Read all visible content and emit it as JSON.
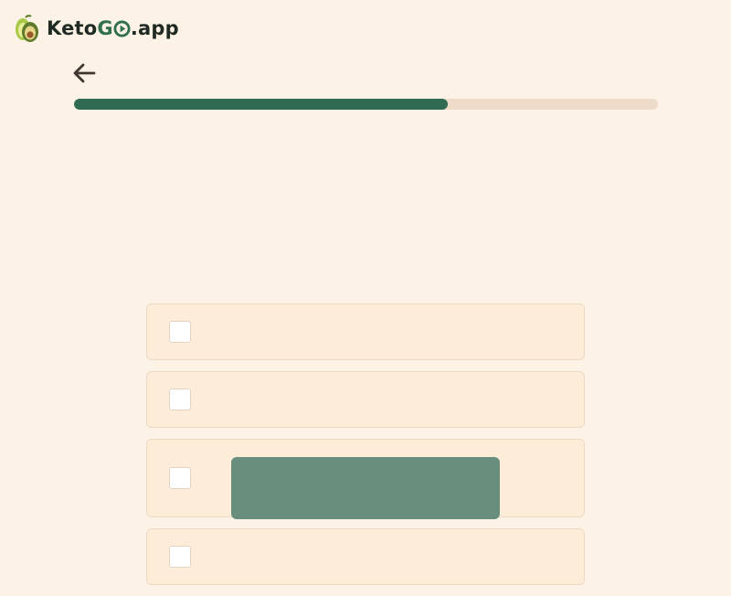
{
  "header": {
    "brand_prefix": "Keto",
    "brand_go_letter": "G",
    "brand_suffix": ".app",
    "logo_icon": "avocado-icon",
    "back_icon": "arrow-left-icon"
  },
  "progress": {
    "value_percent": 64
  },
  "options": [
    {
      "label": "",
      "checked": false
    },
    {
      "label": "",
      "checked": false
    },
    {
      "label": "",
      "checked": false
    },
    {
      "label": "",
      "checked": false
    }
  ],
  "colors": {
    "background": "#fdf2e6",
    "accent_green": "#2f6b52",
    "progress_track": "#efdcc8",
    "option_bg": "#fdecd8",
    "overlay_block": "#688e7e"
  }
}
